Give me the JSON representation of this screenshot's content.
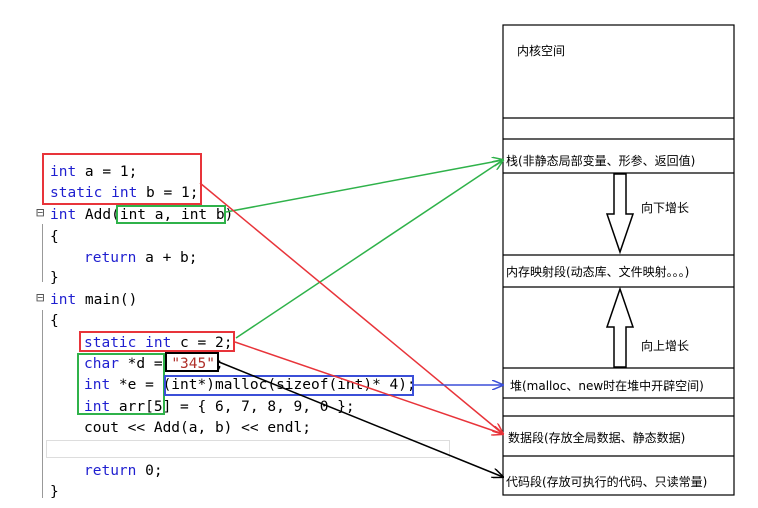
{
  "code": {
    "line1": {
      "kw": "int",
      "rest": " a = 1;"
    },
    "line2": {
      "kw": "static int",
      "rest": " b = 1;"
    },
    "line3": {
      "kw": "int",
      "rest": " Add(int a, int b)"
    },
    "line4": "{",
    "line5": {
      "kw": "return",
      "rest": " a + b;"
    },
    "line6": "}",
    "line7": {
      "kw": "int",
      "rest": " main()"
    },
    "line8": "{",
    "line9": {
      "kw": "static int",
      "rest": " c = 2;"
    },
    "line10": {
      "kw": "char",
      "rest": " *d = ",
      "str": "\"345\"",
      "end": ";"
    },
    "line11": {
      "kw": "int",
      "rest": " *e = (int*)malloc(sizeof(int)* 4);"
    },
    "line12": {
      "kw": "int",
      "rest": " arr[5] = { 6, 7, 8, 9, 0 };"
    },
    "line13": "cout << Add(a, b) << endl;",
    "line14": {
      "kw": "return",
      "rest": " 0;"
    },
    "line15": "}"
  },
  "memory": {
    "kernel": "内核空间",
    "stack": "栈(非静态局部变量、形参、返回值)",
    "grow_down": "向下增长",
    "mmap": "内存映射段(动态库、文件映射。。。)",
    "grow_up": "向上增长",
    "heap": "堆(malloc、new时在堆中开辟空间)",
    "data": "数据段(存放全局数据、静态数据)",
    "code": "代码段(存放可执行的代码、只读常量)"
  },
  "colors": {
    "red": "#e8343a",
    "green": "#2fb24a",
    "blue": "#3b4fd8",
    "black": "#000000",
    "keyword": "#1f1fd0"
  }
}
